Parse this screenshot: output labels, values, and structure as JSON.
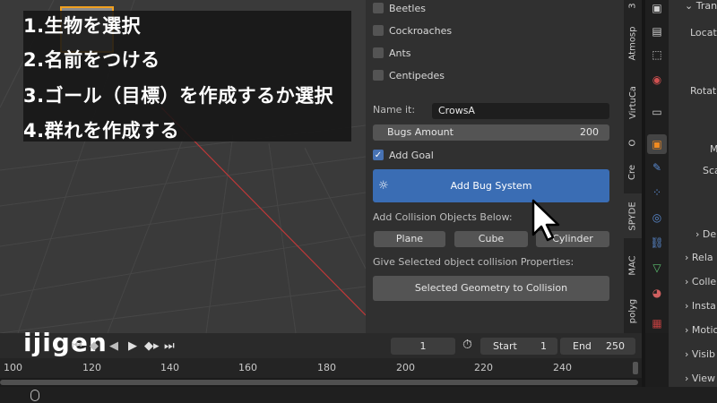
{
  "overlay": {
    "steps": [
      "1.生物を選択",
      "2.名前をつける",
      "3.ゴール（目標）を作成するか選択",
      "4.群れを作成する"
    ],
    "logo_text": "ijigen"
  },
  "bugs": {
    "items": [
      {
        "label": "Beetles",
        "checked": false
      },
      {
        "label": "Cockroaches",
        "checked": false
      },
      {
        "label": "Ants",
        "checked": false
      },
      {
        "label": "Centipedes",
        "checked": false
      }
    ],
    "name_label": "Name it:",
    "name_value": "CrowsA",
    "amount_label": "Bugs Amount",
    "amount_value": "200",
    "add_goal_label": "Add Goal",
    "add_goal_checked": true,
    "add_button": "Add Bug System",
    "collision_label": "Add Collision Objects Below:",
    "collision_buttons": [
      "Plane",
      "Cube",
      "Cylinder"
    ],
    "give_label": "Give Selected object collision Properties:",
    "geometry_button": "Selected Geometry to Collision"
  },
  "side_tabs": [
    "3",
    "Atmosp",
    "VirtuCa",
    "O",
    "Cre",
    "SPYDE",
    "MAC",
    "polyg"
  ],
  "active_tab": "SPYDE",
  "properties": {
    "texts": [
      "Tran",
      "Locati",
      "Rotati",
      "M",
      "Sca",
      "De",
      "Rela",
      "Colle",
      "Insta",
      "Motio",
      "Visib",
      "View"
    ]
  },
  "timeline": {
    "current_frame": "1",
    "start_label": "Start",
    "start_value": "1",
    "end_label": "End",
    "end_value": "250",
    "ruler": [
      "100",
      "120",
      "140",
      "160",
      "180",
      "200",
      "220",
      "240"
    ]
  },
  "colors": {
    "accent_blue": "#3a6db4",
    "overlay_bg": "#161616",
    "cube_outline": "#f0a020",
    "axis_red": "#c03838"
  },
  "icons": [
    "settings-gear-icon",
    "mouse-cursor-icon",
    "mouse-icon",
    "play-icon",
    "stopwatch-icon"
  ]
}
